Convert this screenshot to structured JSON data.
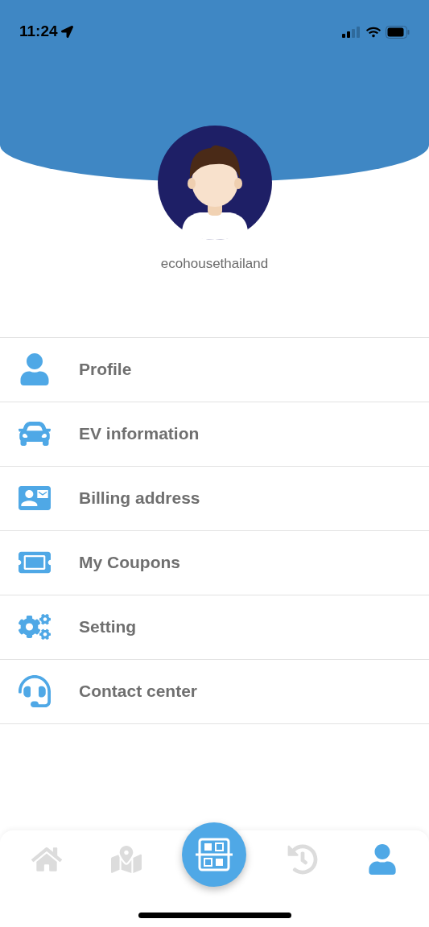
{
  "status_bar": {
    "time": "11:24"
  },
  "profile": {
    "username": "ecohousethailand"
  },
  "menu": [
    {
      "label": "Profile"
    },
    {
      "label": "EV information"
    },
    {
      "label": "Billing address"
    },
    {
      "label": "My Coupons"
    },
    {
      "label": "Setting"
    },
    {
      "label": "Contact center"
    }
  ],
  "bottom_nav": [
    {
      "kind": "tab",
      "selected": false
    },
    {
      "kind": "tab",
      "selected": false
    },
    {
      "kind": "scan",
      "selected": false
    },
    {
      "kind": "tab",
      "selected": false
    },
    {
      "kind": "tab",
      "selected": true
    }
  ]
}
